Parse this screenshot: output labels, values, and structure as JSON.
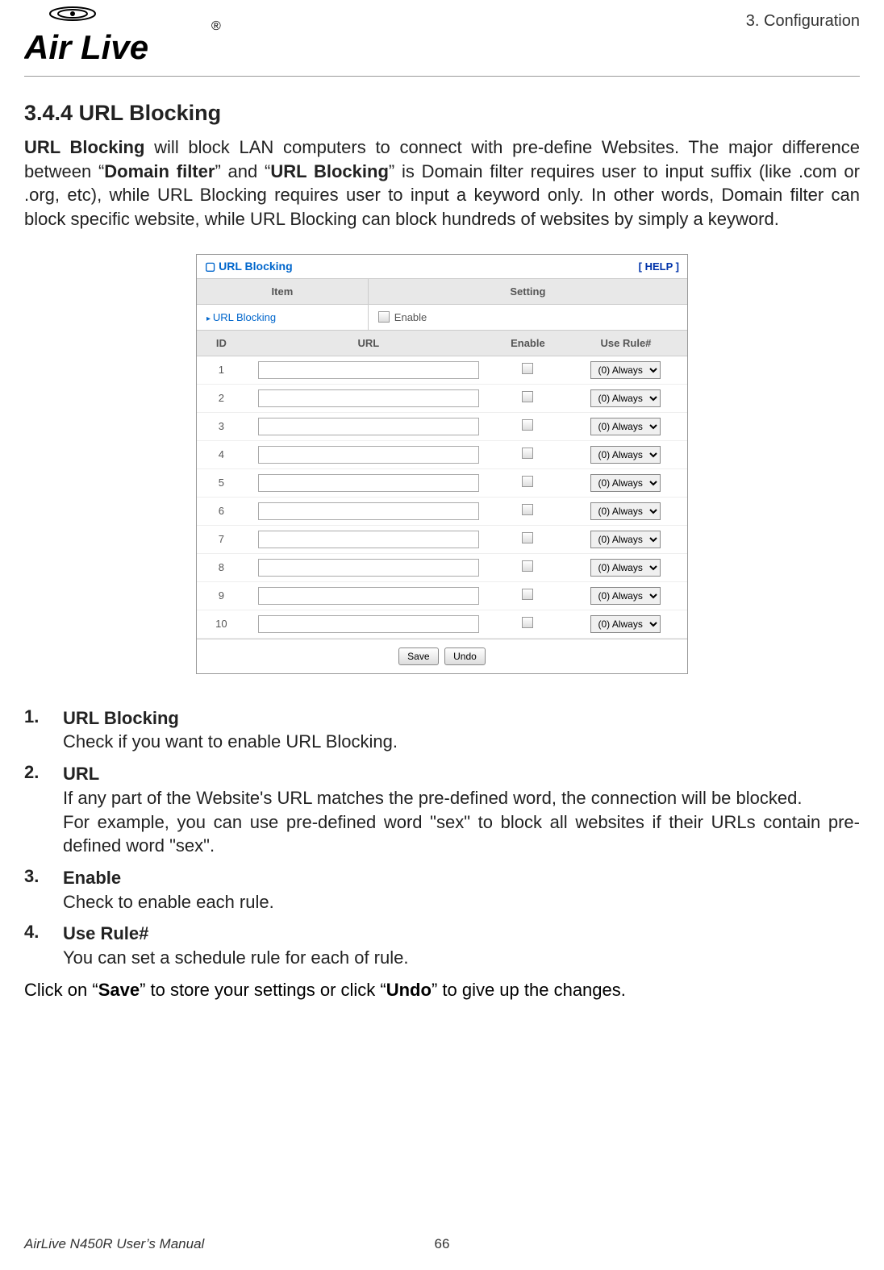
{
  "breadcrumb": "3.  Configuration",
  "section_number": "3.4.4",
  "section_title": "URL Blocking",
  "intro": {
    "p1_a": "URL Blocking",
    "p1_b": " will block LAN computers to connect with pre-define Websites. The major difference between “",
    "p1_c": "Domain filter",
    "p1_d": "” and “",
    "p1_e": "URL Blocking",
    "p1_f": "” is Domain filter requires user to input suffix (like .com or .org, etc), while URL Blocking requires user to input a keyword only. In other words, Domain filter can block specific website, while URL Blocking can block hundreds of websites by simply a keyword."
  },
  "panel": {
    "title": "URL Blocking",
    "help": "[ HELP ]",
    "col_item": "Item",
    "col_setting": "Setting",
    "enable_label": "URL Blocking",
    "enable_text": "Enable",
    "headers": {
      "id": "ID",
      "url": "URL",
      "enable": "Enable",
      "use_rule": "Use Rule#"
    },
    "rows": [
      {
        "id": "1",
        "rule": "(0) Always"
      },
      {
        "id": "2",
        "rule": "(0) Always"
      },
      {
        "id": "3",
        "rule": "(0) Always"
      },
      {
        "id": "4",
        "rule": "(0) Always"
      },
      {
        "id": "5",
        "rule": "(0) Always"
      },
      {
        "id": "6",
        "rule": "(0) Always"
      },
      {
        "id": "7",
        "rule": "(0) Always"
      },
      {
        "id": "8",
        "rule": "(0) Always"
      },
      {
        "id": "9",
        "rule": "(0) Always"
      },
      {
        "id": "10",
        "rule": "(0) Always"
      }
    ],
    "save": "Save",
    "undo": "Undo"
  },
  "items": [
    {
      "num": "1.",
      "heading": "URL Blocking",
      "lines": [
        "Check if you want to enable URL Blocking."
      ]
    },
    {
      "num": "2.",
      "heading": "URL",
      "lines": [
        "If any part of the Website's URL matches the pre-defined word, the connection will be blocked.",
        "For example, you can use pre-defined word \"sex\" to block all websites if their URLs contain pre-defined word \"sex\"."
      ]
    },
    {
      "num": "3.",
      "heading": "Enable",
      "lines": [
        "Check to enable each rule."
      ]
    },
    {
      "num": "4.",
      "heading": "Use Rule#",
      "lines": [
        "You can set a schedule rule for each of rule."
      ]
    }
  ],
  "closing": {
    "a": "Click on “",
    "b": "Save",
    "c": "” to store your settings or click “",
    "d": "Undo",
    "e": "” to give up the changes."
  },
  "footer": {
    "left": "AirLive N450R User’s Manual",
    "page": "66"
  }
}
